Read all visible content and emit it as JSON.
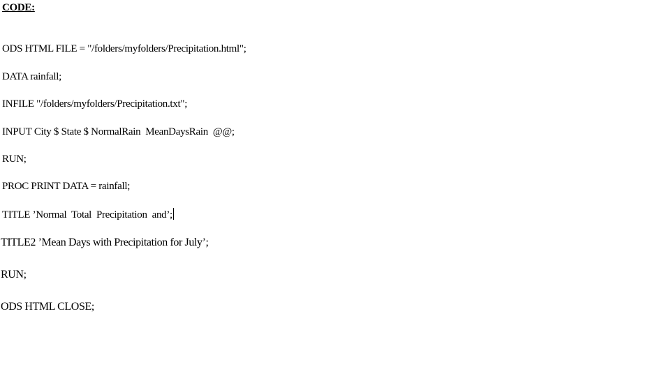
{
  "document": {
    "heading": "CODE:",
    "lines": [
      "ODS HTML FILE = \"/folders/myfolders/Precipitation.html\";",
      "DATA rainfall;",
      "INFILE \"/folders/myfolders/Precipitation.txt\";",
      "INPUT City $ State $ NormalRain  MeanDaysRain  @@;",
      "RUN;",
      "PROC PRINT DATA = rainfall;",
      "TITLE ’Normal  Total  Precipitation  and’;",
      "TITLE2 ’Mean Days with Precipitation for July’;",
      "RUN;",
      "ODS HTML CLOSE;"
    ]
  }
}
